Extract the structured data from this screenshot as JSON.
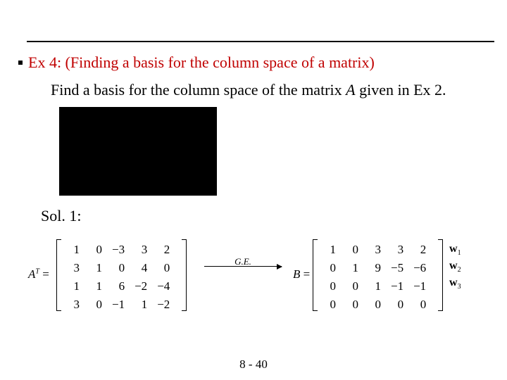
{
  "title": "Ex 4: (Finding a basis for the column space of a matrix)",
  "prompt_pre": "Find a basis for the column space of the matrix ",
  "prompt_A": "A",
  "prompt_post": " given in Ex 2.",
  "sol_label": "Sol. 1:",
  "lhs_label": "A",
  "lhs_sup": "T",
  "eq": " =",
  "matrix_A_T": {
    "rows": [
      [
        "1",
        "0",
        "−3",
        "3",
        "2"
      ],
      [
        "3",
        "1",
        "0",
        "4",
        "0"
      ],
      [
        "1",
        "1",
        "6",
        "−2",
        "−4"
      ],
      [
        "3",
        "0",
        "−1",
        "1",
        "−2"
      ]
    ]
  },
  "arrow_label": "G.E.",
  "rhs_label": "B",
  "matrix_B": {
    "rows": [
      [
        "1",
        "0",
        "3",
        "3",
        "2"
      ],
      [
        "0",
        "1",
        "9",
        "−5",
        "−6"
      ],
      [
        "0",
        "0",
        "1",
        "−1",
        "−1"
      ],
      [
        "0",
        "0",
        "0",
        "0",
        "0"
      ]
    ]
  },
  "w_labels": [
    "w",
    "w",
    "w"
  ],
  "w_subs": [
    "1",
    "2",
    "3"
  ],
  "page_number": "8 - 40"
}
